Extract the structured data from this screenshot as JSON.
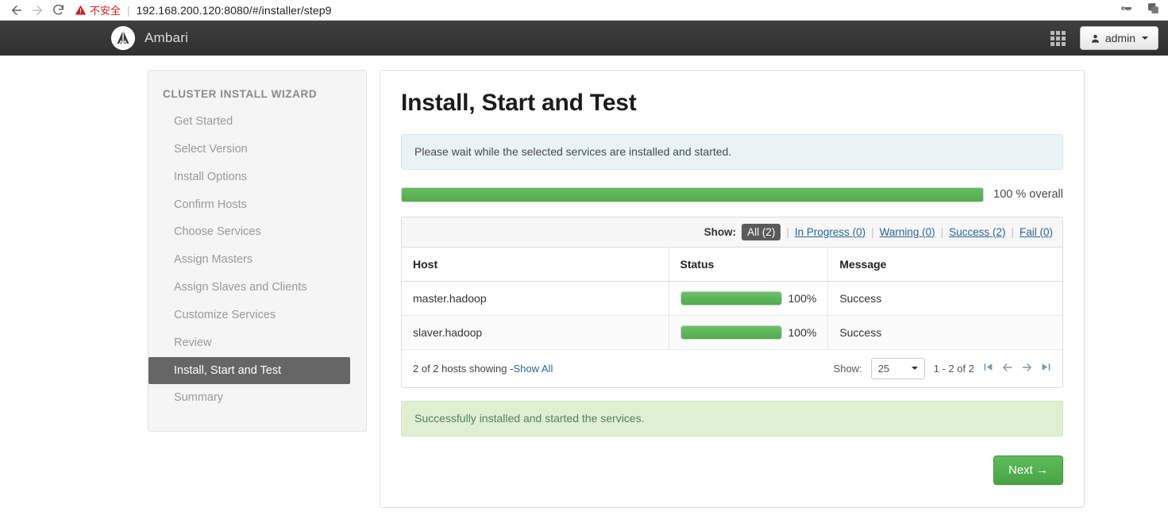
{
  "browser": {
    "back_icon": "back-arrow-icon",
    "forward_icon": "forward-arrow-icon",
    "reload_icon": "reload-icon",
    "security_label": "不安全",
    "url": "192.168.200.120:8080/#/installer/step9",
    "password_key_icon": "key-icon",
    "extension_icon": "extension-icon"
  },
  "header": {
    "brand": "Ambari",
    "logo_icon": "ambari-logo-icon",
    "apps_grid_icon": "apps-grid-icon",
    "user_icon": "user-icon",
    "user_label": "admin"
  },
  "sidebar": {
    "title": "CLUSTER INSTALL WIZARD",
    "items": [
      {
        "label": "Get Started",
        "active": false
      },
      {
        "label": "Select Version",
        "active": false
      },
      {
        "label": "Install Options",
        "active": false
      },
      {
        "label": "Confirm Hosts",
        "active": false
      },
      {
        "label": "Choose Services",
        "active": false
      },
      {
        "label": "Assign Masters",
        "active": false
      },
      {
        "label": "Assign Slaves and Clients",
        "active": false
      },
      {
        "label": "Customize Services",
        "active": false
      },
      {
        "label": "Review",
        "active": false
      },
      {
        "label": "Install, Start and Test",
        "active": true
      },
      {
        "label": "Summary",
        "active": false
      }
    ]
  },
  "main": {
    "title": "Install, Start and Test",
    "info_message": "Please wait while the selected services are installed and started.",
    "overall_progress": {
      "percent": 100,
      "label": "100 % overall"
    },
    "filters": {
      "show_label": "Show:",
      "items": [
        {
          "label": "All (2)",
          "active": true
        },
        {
          "label": "In Progress (0)",
          "active": false
        },
        {
          "label": "Warning (0)",
          "active": false
        },
        {
          "label": "Success (2)",
          "active": false
        },
        {
          "label": "Fail (0)",
          "active": false
        }
      ]
    },
    "table": {
      "columns": [
        "Host",
        "Status",
        "Message"
      ],
      "rows": [
        {
          "host": "master.hadoop",
          "percent": 100,
          "percent_label": "100%",
          "message": "Success"
        },
        {
          "host": "slaver.hadoop",
          "percent": 100,
          "percent_label": "100%",
          "message": "Success"
        }
      ]
    },
    "pagination": {
      "summary": "2 of 2 hosts showing - ",
      "show_all": "Show All",
      "show_label": "Show:",
      "page_size": "25",
      "range": "1 - 2 of 2",
      "first_icon": "first-page-icon",
      "prev_icon": "previous-page-icon",
      "next_icon": "next-page-icon",
      "last_icon": "last-page-icon"
    },
    "success_message": "Successfully installed and started the services.",
    "next_button": "Next →"
  },
  "colors": {
    "progress_green": "#5cb85c",
    "header_dark": "#333333",
    "active_step": "#666666",
    "link_blue": "#2a6496",
    "success_text": "#5aa05a",
    "insecure_red": "#c5221f"
  }
}
